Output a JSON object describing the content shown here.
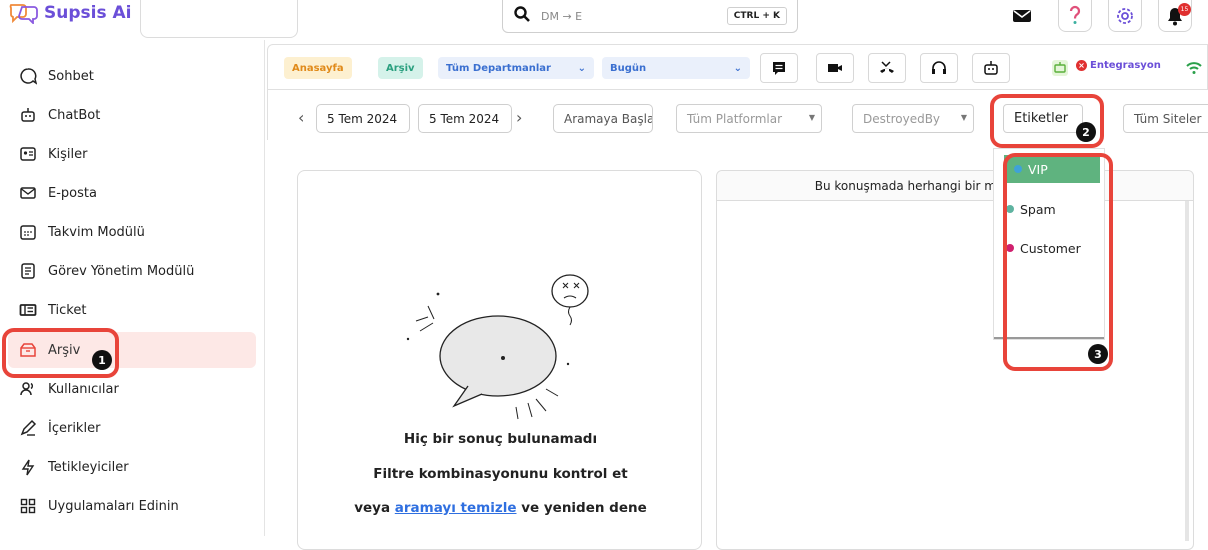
{
  "app": {
    "name": "Supsis Ai"
  },
  "search": {
    "placeholder": "DM → E",
    "shortcut": "CTRL + K"
  },
  "notifications": {
    "count": "15"
  },
  "sidebar": {
    "items": [
      {
        "label": "Sohbet",
        "icon": "chat-icon"
      },
      {
        "label": "ChatBot",
        "icon": "robot-icon"
      },
      {
        "label": "Kişiler",
        "icon": "contact-card-icon"
      },
      {
        "label": "E-posta",
        "icon": "mail-icon"
      },
      {
        "label": "Takvim Modülü",
        "icon": "calendar-icon"
      },
      {
        "label": "Görev Yönetim Modülü",
        "icon": "task-list-icon"
      },
      {
        "label": "Ticket",
        "icon": "ticket-icon"
      },
      {
        "label": "Arşiv",
        "icon": "archive-icon",
        "active": true
      },
      {
        "label": "Kullanıcılar",
        "icon": "users-icon"
      },
      {
        "label": "İçerikler",
        "icon": "pen-icon"
      },
      {
        "label": "Tetikleyiciler",
        "icon": "lightning-icon"
      },
      {
        "label": "Uygulamaları Edinin",
        "icon": "apps-grid-icon"
      }
    ]
  },
  "filterbar": {
    "home_label": "Anasayfa",
    "archive_label": "Arşiv",
    "department_label": "Tüm Departmanlar",
    "date_range_label": "Bugün",
    "integration_label": "Entegrasyon"
  },
  "filters": {
    "start_date": "5 Tem 2024",
    "end_date": "5 Tem 2024",
    "search_button": "Aramaya Başla",
    "platforms": "Tüm Platformlar",
    "agent": "DestroyedBy",
    "tags_input": "Etiketler",
    "sites": "Tüm Siteler"
  },
  "empty_state": {
    "title": "Hiç bir sonuç bulunamadı",
    "line2": "Filtre kombinasyonunu kontrol et",
    "line3_prefix": "veya",
    "line3_link": "aramayı temizle",
    "line3_suffix": "ve yeniden dene"
  },
  "conversation_panel": {
    "header": "Bu konuşmada herhangi bir mesaj bulunamadı"
  },
  "tags_dropdown": {
    "options": [
      {
        "label": "VIP",
        "color": "#3fa2d8",
        "selected": true
      },
      {
        "label": "Spam",
        "color": "#5fb3a0"
      },
      {
        "label": "Customer",
        "color": "#d0206e"
      }
    ]
  },
  "annotations": {
    "step1": "1",
    "step2": "2",
    "step3": "3"
  },
  "colors": {
    "accent": "#6b4fd8",
    "highlight": "#e8443a",
    "selected": "#5fb37f"
  }
}
